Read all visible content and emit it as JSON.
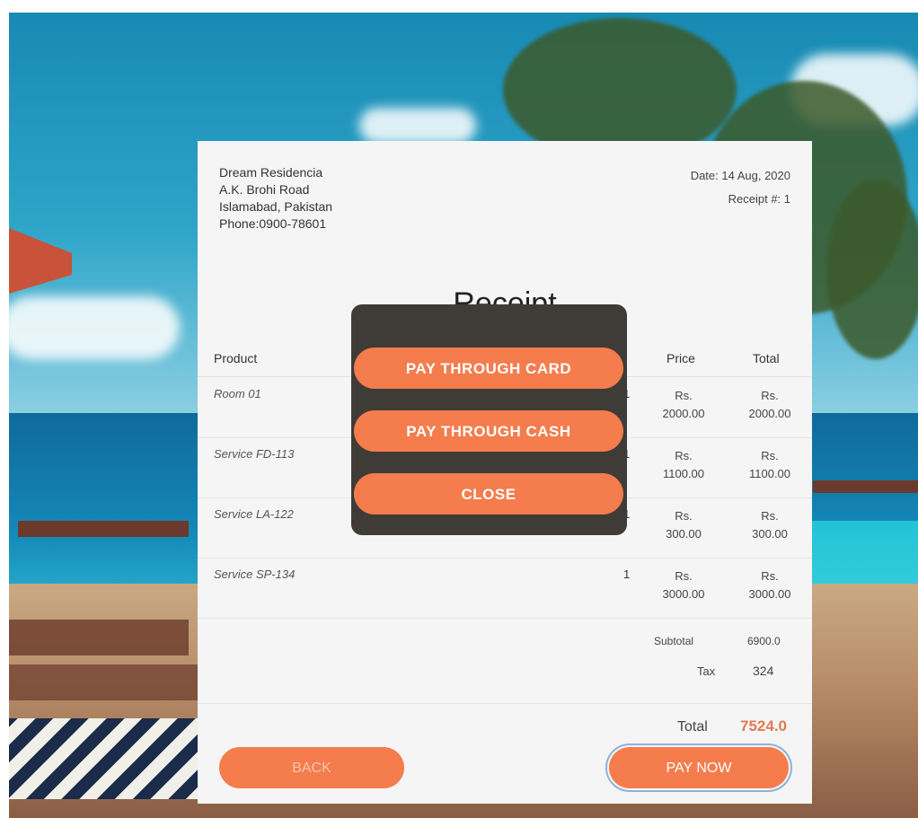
{
  "business": {
    "name": "Dream Residencia",
    "address": "A.K. Brohi Road",
    "city": "Islamabad, Pakistan",
    "phone": "Phone:0900-78601"
  },
  "meta": {
    "date": "Date: 14 Aug, 2020",
    "receipt": "Receipt #: 1"
  },
  "receipt_title": "Receipt",
  "table": {
    "headers": {
      "product": "Product",
      "price": "Price",
      "total": "Total"
    },
    "rows": [
      {
        "name": "Room 01",
        "qty": "1",
        "price_cur": "Rs.",
        "price": "2000.00",
        "total_cur": "Rs.",
        "total": "2000.00"
      },
      {
        "name": "Service FD-113",
        "qty": "1",
        "price_cur": "Rs.",
        "price": "1100.00",
        "total_cur": "Rs.",
        "total": "1100.00"
      },
      {
        "name": "Service LA-122",
        "qty": "1",
        "price_cur": "Rs.",
        "price": "300.00",
        "total_cur": "Rs.",
        "total": "300.00"
      },
      {
        "name": "Service SP-134",
        "qty": "1",
        "price_cur": "Rs.",
        "price": "3000.00",
        "total_cur": "Rs.",
        "total": "3000.00"
      }
    ]
  },
  "summary": {
    "subtotal_label": "Subtotal",
    "subtotal_value": "6900.0",
    "tax_label": "Tax",
    "tax_value": "324",
    "total_label": "Total",
    "total_value": "7524.0"
  },
  "buttons": {
    "back": "BACK",
    "pay_now": "PAY NOW"
  },
  "modal": {
    "card": "PAY THROUGH CARD",
    "cash": "PAY THROUGH CASH",
    "close": "CLOSE"
  },
  "colors": {
    "accent": "#f47c4d",
    "modal_bg": "#3f3b37",
    "total_value": "#e07a55"
  }
}
